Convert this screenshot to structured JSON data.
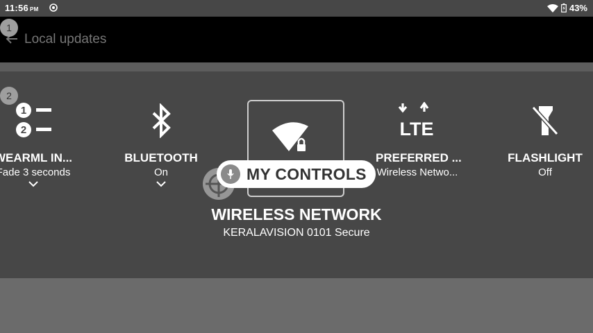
{
  "status_bar": {
    "time": "11:56",
    "ampm": "PM",
    "battery": "43%"
  },
  "app_bar": {
    "title": "Local updates"
  },
  "badges": [
    "1",
    "2"
  ],
  "tiles": [
    {
      "label": "WEARML IN...",
      "sub": "Fade 3 seconds",
      "icon": "numbered-list-icon",
      "numbers": [
        "1",
        "2"
      ]
    },
    {
      "label": "BLUETOOTH",
      "sub": "On",
      "icon": "bluetooth-icon"
    },
    {
      "label": "WIRELESS NETWORK",
      "sub": "KERALAVISION 0101 Secure",
      "icon": "wifi-lock-icon"
    },
    {
      "label": "PREFERRED ...",
      "sub": "Wireless Netwo...",
      "icon": "lte-icon",
      "icon_text": "LTE"
    },
    {
      "label": "FLASHLIGHT",
      "sub": "Off",
      "icon": "flashlight-off-icon"
    }
  ],
  "voice_overlay": {
    "label": "MY CONTROLS"
  }
}
